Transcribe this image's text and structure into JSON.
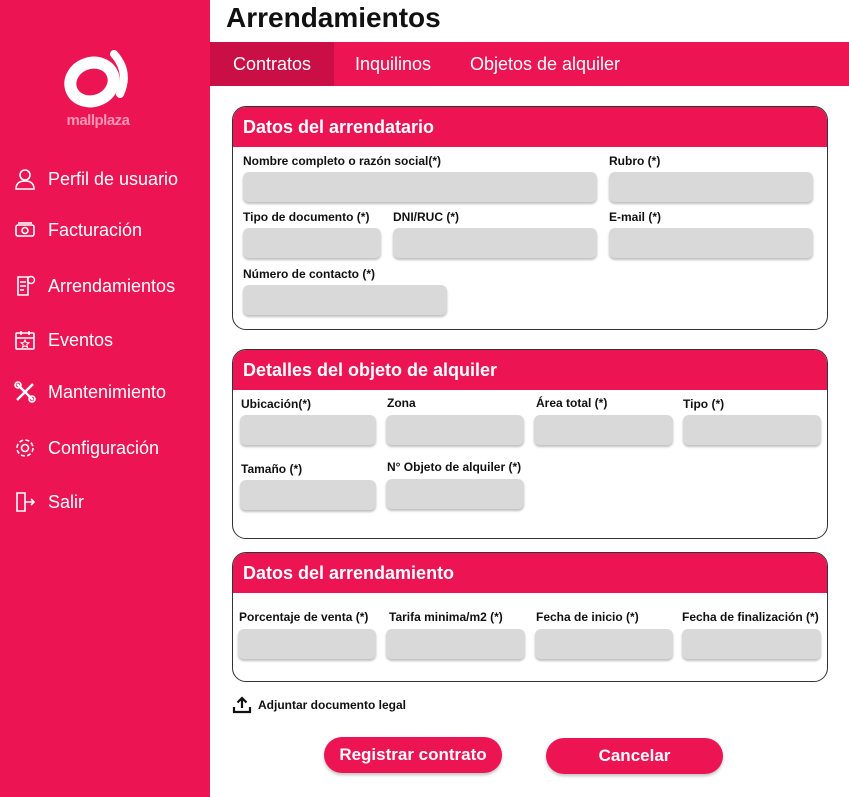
{
  "brand": {
    "name": "mallplaza",
    "color": "#ec1452"
  },
  "sidebar": {
    "items": [
      {
        "label": "Perfil de usuario",
        "icon": "user-icon"
      },
      {
        "label": "Facturación",
        "icon": "money-icon"
      },
      {
        "label": "Arrendamientos",
        "icon": "document-dollar-icon"
      },
      {
        "label": "Eventos",
        "icon": "calendar-star-icon"
      },
      {
        "label": "Mantenimiento",
        "icon": "tools-icon"
      },
      {
        "label": "Configuración",
        "icon": "gear-icon"
      },
      {
        "label": "Salir",
        "icon": "logout-icon"
      }
    ]
  },
  "header": {
    "title": "Arrendamientos"
  },
  "tabs": [
    {
      "label": "Contratos",
      "active": true
    },
    {
      "label": "Inquilinos",
      "active": false
    },
    {
      "label": "Objetos de alquiler",
      "active": false
    }
  ],
  "sections": {
    "arrendatario": {
      "title": "Datos del arrendatario",
      "fields": {
        "nombre": "Nombre completo o razón social(*)",
        "rubro": "Rubro (*)",
        "tipo_doc": "Tipo de documento (*)",
        "dni": "DNI/RUC (*)",
        "email": "E-mail (*)",
        "contacto": "Número de contacto (*)"
      }
    },
    "objeto": {
      "title": "Detalles del objeto de alquiler",
      "fields": {
        "ubicacion": "Ubicación(*)",
        "zona": "Zona",
        "area": "Área total (*)",
        "tipo": "Tipo (*)",
        "tamano": "Tamaño (*)",
        "numero": "N° Objeto de alquiler (*)"
      }
    },
    "arrendamiento": {
      "title": "Datos del arrendamiento",
      "fields": {
        "porcentaje": "Porcentaje de venta (*)",
        "tarifa": "Tarifa minima/m2 (*)",
        "inicio": "Fecha de inicio (*)",
        "fin": "Fecha de finalización (*)"
      }
    }
  },
  "attach": {
    "label": "Adjuntar documento legal",
    "icon": "upload-icon"
  },
  "actions": {
    "register": "Registrar contrato",
    "cancel": "Cancelar"
  }
}
